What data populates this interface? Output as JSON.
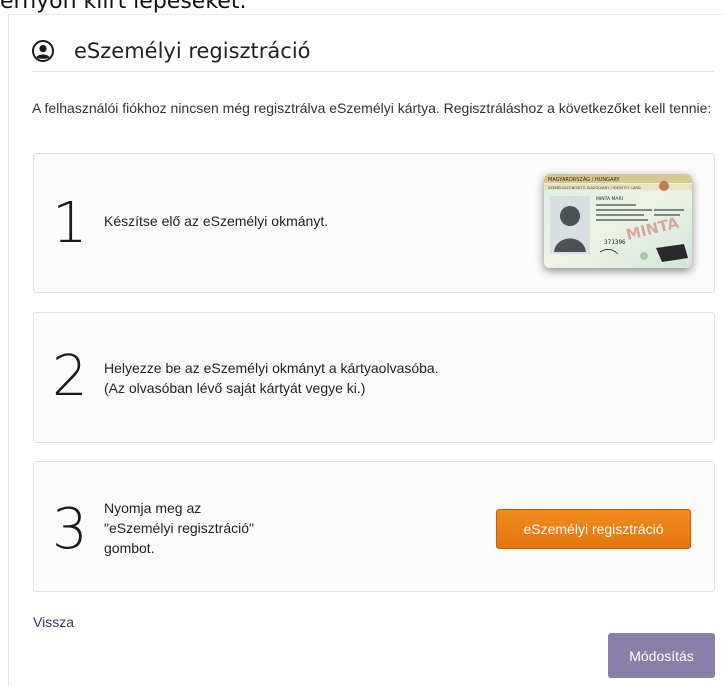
{
  "top_text": "ernyőn kiírt lépéseket.",
  "header": {
    "title": "eSzemélyi regisztráció",
    "icon": "user-circle-icon"
  },
  "intro": "A felhasználói fiókhoz nincsen még regisztrálva eSzemélyi kártya. Regisztráláshoz a következőket kell tennie:",
  "steps": [
    {
      "number": "1",
      "lines": [
        "Készítse elő az eSzemélyi okmányt."
      ]
    },
    {
      "number": "2",
      "lines": [
        "Helyezze be az eSzemélyi okmányt a kártyaolvasóba.",
        "(Az olvasóban lévő saját kártyát vegye ki.)"
      ]
    },
    {
      "number": "3",
      "lines": [
        "Nyomja meg az",
        "\"eSzemélyi regisztráció\"",
        "gombot."
      ]
    }
  ],
  "id_card": {
    "icon": "id-card-image",
    "header_text": "MAGYARORSZÁG / HUNGARY",
    "subheader_text": "SZEMÉLYAZONOSÍTÓ IGAZOLVÁNY / IDENTITY CARD",
    "name_text": "MINTA MARI",
    "stamp_text": "MINTA",
    "number_text": "371396"
  },
  "register_button": {
    "label": "eSzemélyi regisztráció"
  },
  "footer": {
    "back_label": "Vissza",
    "modify_label": "Módosítás"
  },
  "colors": {
    "accent_orange": "#e9801a",
    "modify_purple": "#8a7fa6",
    "link_blue": "#2b3b6b"
  }
}
